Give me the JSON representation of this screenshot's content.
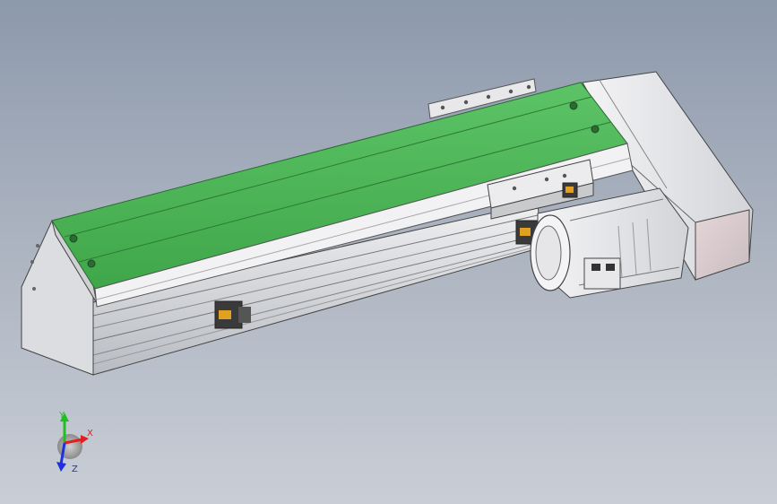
{
  "viewport": {
    "background_top": "#8d99ac",
    "background_bottom": "#c9ced6"
  },
  "model": {
    "belt_color": "#4fb85a",
    "frame_color": "#d6d8dc",
    "motor_color": "#e6e6e8",
    "accent_color": "#e0a020"
  },
  "triad": {
    "x_label": "X",
    "y_label": "Y",
    "z_label": "Z",
    "x_color": "#e02020",
    "y_color": "#20c020",
    "z_color": "#2030e0"
  }
}
